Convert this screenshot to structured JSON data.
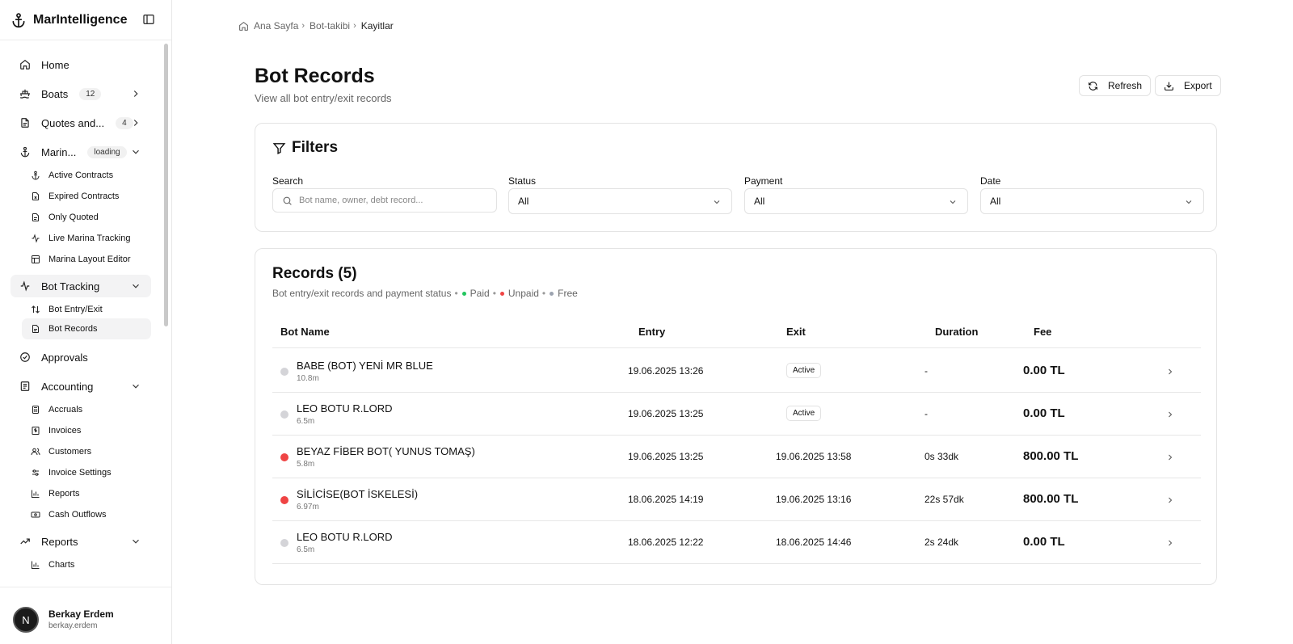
{
  "app": {
    "name": "MarIntelligence"
  },
  "sidebar": {
    "nav": [
      {
        "label": "Home",
        "icon": "home-icon"
      },
      {
        "label": "Boats",
        "badge": "12",
        "icon": "ship-icon"
      },
      {
        "label": "Quotes and...",
        "badge": "4",
        "icon": "document-icon"
      },
      {
        "label": "Marin...",
        "badge": "loading",
        "icon": "anchor-icon"
      },
      {
        "label": "Bot Tracking",
        "icon": "activity-icon"
      },
      {
        "label": "Approvals",
        "icon": "check-circle-icon"
      },
      {
        "label": "Accounting",
        "icon": "ledger-icon"
      },
      {
        "label": "Reports",
        "icon": "trending-up-icon"
      }
    ],
    "marina_sub": [
      "Active Contracts",
      "Expired Contracts",
      "Only Quoted",
      "Live Marina Tracking",
      "Marina Layout Editor"
    ],
    "bot_sub": [
      "Bot Entry/Exit",
      "Bot Records"
    ],
    "accounting_sub": [
      "Accruals",
      "Invoices",
      "Customers",
      "Invoice Settings",
      "Reports",
      "Cash Outflows"
    ],
    "reports_sub": [
      "Charts"
    ]
  },
  "user": {
    "initial": "N",
    "name": "Berkay Erdem",
    "handle": "berkay.erdem"
  },
  "breadcrumb": {
    "home": "Ana Sayfa",
    "parent": "Bot-takibi",
    "current": "Kayitlar"
  },
  "page": {
    "title": "Bot Records",
    "subtitle": "View all bot entry/exit records"
  },
  "actions": {
    "refresh": "Refresh",
    "export": "Export"
  },
  "filters": {
    "title": "Filters",
    "search_label": "Search",
    "search_placeholder": "Bot name, owner, debt record...",
    "status_label": "Status",
    "status_value": "All",
    "payment_label": "Payment",
    "payment_value": "All",
    "date_label": "Date",
    "date_value": "All"
  },
  "records": {
    "title": "Records (5)",
    "desc": "Bot entry/exit records and payment status",
    "legend": {
      "paid": "Paid",
      "unpaid": "Unpaid",
      "free": "Free"
    },
    "legend_colors": {
      "paid": "#22c55e",
      "unpaid": "#ef4444",
      "free": "#9ca3af"
    },
    "columns": {
      "name": "Bot Name",
      "entry": "Entry",
      "exit": "Exit",
      "duration": "Duration",
      "fee": "Fee"
    },
    "rows": [
      {
        "name": "BABE (BOT) YENİ MR BLUE",
        "length": "10.8m",
        "entry": "19.06.2025 13:26",
        "exit": "Active",
        "duration": "-",
        "fee": "0.00 TL",
        "status_color": "#d4d4d8"
      },
      {
        "name": "LEO BOTU R.LORD",
        "length": "6.5m",
        "entry": "19.06.2025 13:25",
        "exit": "Active",
        "duration": "-",
        "fee": "0.00 TL",
        "status_color": "#d4d4d8"
      },
      {
        "name": "BEYAZ FİBER BOT( YUNUS TOMAŞ)",
        "length": "5.8m",
        "entry": "19.06.2025 13:25",
        "exit": "19.06.2025 13:58",
        "duration": "0s 33dk",
        "fee": "800.00 TL",
        "status_color": "#ef4444"
      },
      {
        "name": "SİLİCİSE(BOT İSKELESİ)",
        "length": "6.97m",
        "entry": "18.06.2025 14:19",
        "exit": "19.06.2025 13:16",
        "duration": "22s 57dk",
        "fee": "800.00 TL",
        "status_color": "#ef4444"
      },
      {
        "name": "LEO BOTU R.LORD",
        "length": "6.5m",
        "entry": "18.06.2025 12:22",
        "exit": "18.06.2025 14:46",
        "duration": "2s 24dk",
        "fee": "0.00 TL",
        "status_color": "#d4d4d8"
      }
    ]
  }
}
